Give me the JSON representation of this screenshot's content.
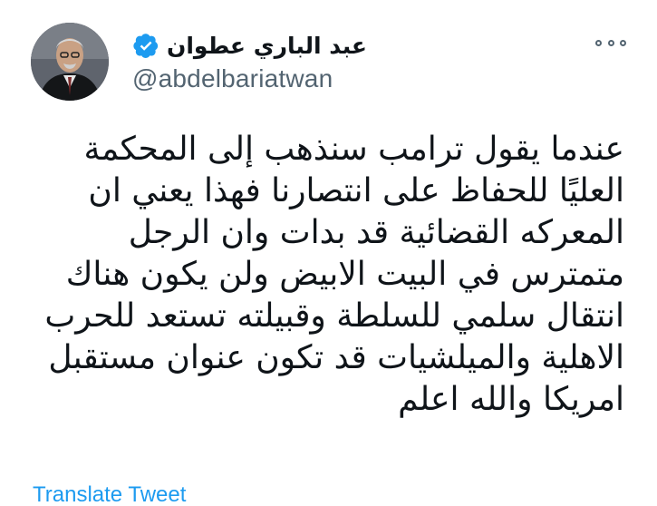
{
  "author": {
    "display_name": "عبد الباري عطوان",
    "handle": "@abdelbariatwan",
    "verified": true,
    "avatar_icon": "profile-photo"
  },
  "menu": {
    "icon": "more-options-icon"
  },
  "tweet": {
    "lines": [
      "عندما يقول ترامب سنذهب إلى المحكمة",
      "العليًا للحفاظ على انتصارنا فهذا يعني ان",
      "المعركه القضائية قد بدات وان الرجل",
      "متمترس في البيت الابيض ولن يكون هناك",
      "انتقال سلمي للسلطة وقبيلته تستعد للحرب",
      "الاهلية والميلشيات قد تكون عنوان مستقبل",
      "امريكا والله اعلم"
    ]
  },
  "actions": {
    "translate_label": "Translate Tweet"
  },
  "colors": {
    "text": "#0f1419",
    "secondary": "#536471",
    "accent": "#1d9bf0"
  }
}
